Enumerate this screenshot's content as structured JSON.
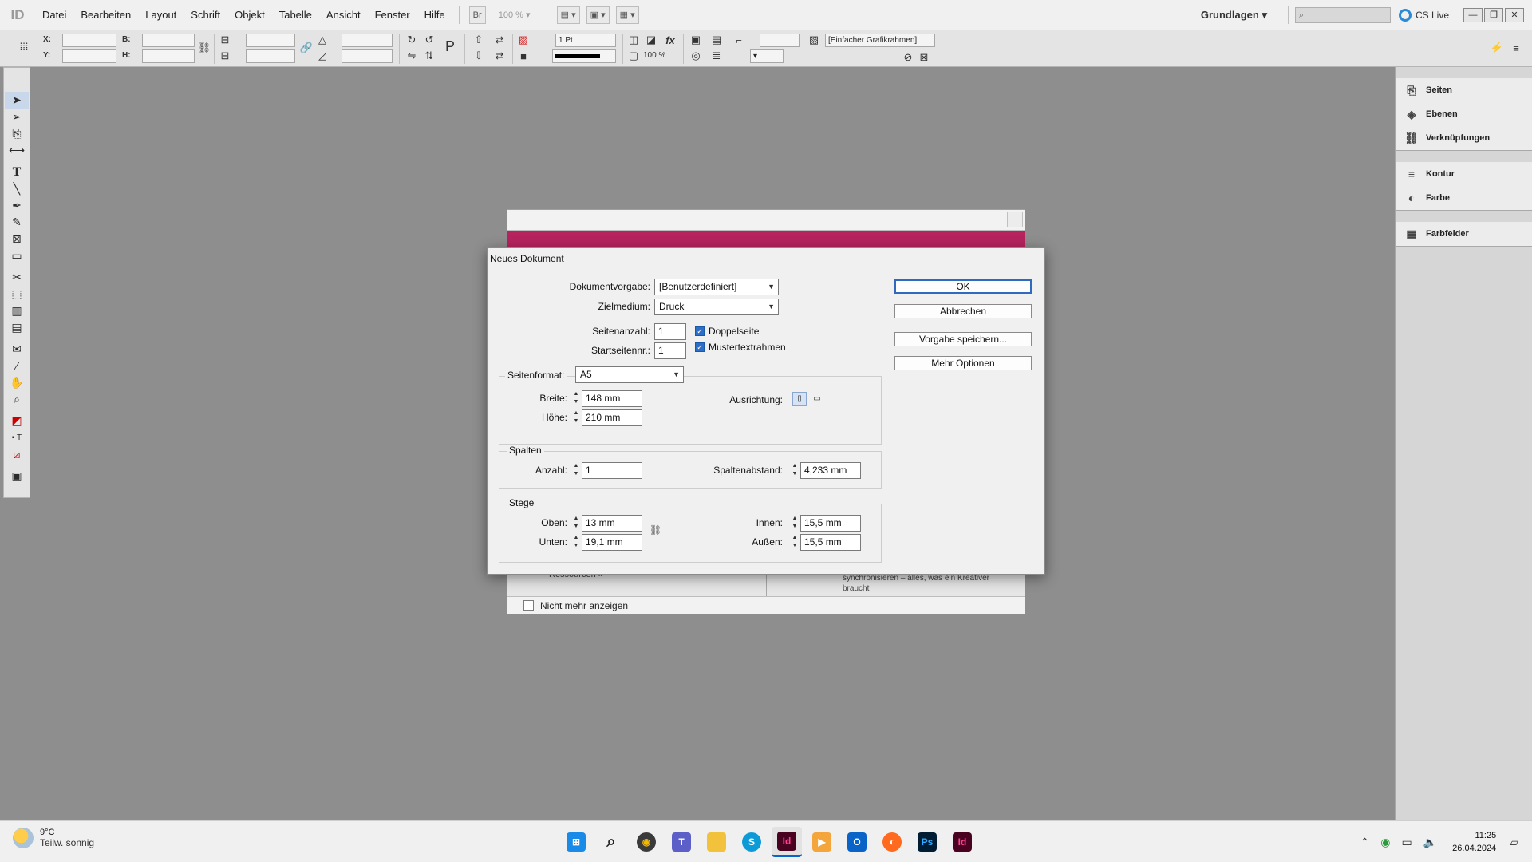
{
  "app": {
    "logo": "ID"
  },
  "menu": {
    "items": [
      "Datei",
      "Bearbeiten",
      "Layout",
      "Schrift",
      "Objekt",
      "Tabelle",
      "Ansicht",
      "Fenster",
      "Hilfe"
    ],
    "bridge_label": "Br",
    "zoom": "100 %",
    "workspace": "Grundlagen",
    "search_placeholder": "",
    "cs_live": "CS Live"
  },
  "control": {
    "x_label": "X:",
    "y_label": "Y:",
    "w_label": "B:",
    "h_label": "H:",
    "stroke_weight": "1 Pt",
    "opacity": "100 %",
    "frame_style": "[Einfacher Grafikrahmen]"
  },
  "dock": {
    "group1": [
      "Seiten",
      "Ebenen",
      "Verknüpfungen"
    ],
    "group2": [
      "Kontur",
      "Farbe"
    ],
    "group3": [
      "Farbfelder"
    ]
  },
  "welcome": {
    "resources": "Ressourcen »",
    "sync_text": "synchronisieren – alles, was ein Kreativer braucht",
    "dont_show": "Nicht mehr anzeigen"
  },
  "dialog": {
    "title": "Neues Dokument",
    "preset_label": "Dokumentvorgabe:",
    "preset_value": "[Benutzerdefiniert]",
    "intent_label": "Zielmedium:",
    "intent_value": "Druck",
    "pages_label": "Seitenanzahl:",
    "pages_value": "1",
    "start_label": "Startseitennr.:",
    "start_value": "1",
    "facing_label": "Doppelseite",
    "master_label": "Mustertextrahmen",
    "size_label": "Seitenformat:",
    "size_value": "A5",
    "width_label": "Breite:",
    "width_value": "148 mm",
    "height_label": "Höhe:",
    "height_value": "210 mm",
    "orientation_label": "Ausrichtung:",
    "columns_group": "Spalten",
    "columns_count_label": "Anzahl:",
    "columns_count_value": "1",
    "gutter_label": "Spaltenabstand:",
    "gutter_value": "4,233 mm",
    "margins_group": "Stege",
    "top_label": "Oben:",
    "top_value": "13 mm",
    "bottom_label": "Unten:",
    "bottom_value": "19,1 mm",
    "inside_label": "Innen:",
    "inside_value": "15,5 mm",
    "outside_label": "Außen:",
    "outside_value": "15,5 mm",
    "buttons": {
      "ok": "OK",
      "cancel": "Abbrechen",
      "save_preset": "Vorgabe speichern...",
      "more_options": "Mehr Optionen"
    }
  },
  "taskbar": {
    "temp": "9°C",
    "weather": "Teilw. sonnig",
    "time": "11:25",
    "date": "26.04.2024",
    "apps": [
      "windows-start",
      "search",
      "norton",
      "teams",
      "file-explorer",
      "skype",
      "indesign",
      "video-player",
      "outlook",
      "firefox",
      "photoshop",
      "indesign-2"
    ]
  },
  "colors": {
    "accent": "#b6235f",
    "selection": "#2b6fc8",
    "workspace_bg": "#8e8e8e"
  }
}
